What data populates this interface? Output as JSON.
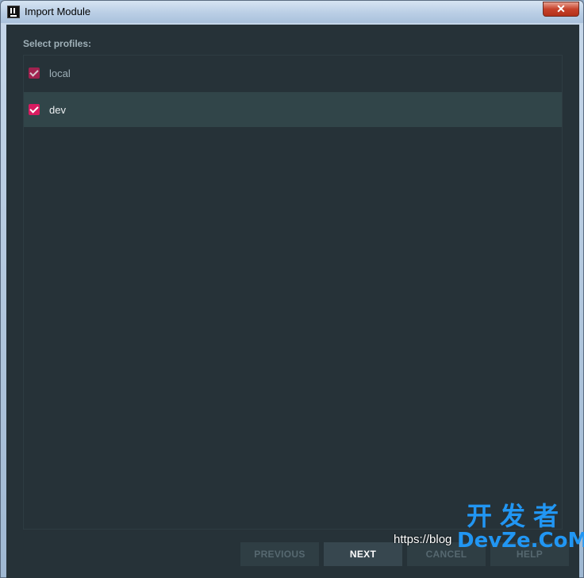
{
  "window": {
    "title": "Import Module",
    "close_glyph": "✕"
  },
  "main": {
    "section_label": "Select profiles:",
    "profiles": [
      {
        "label": "local",
        "checked": true,
        "selected": false
      },
      {
        "label": "dev",
        "checked": true,
        "selected": true
      }
    ]
  },
  "buttons": {
    "previous": "PREVIOUS",
    "next": "NEXT",
    "cancel": "CANCEL",
    "help": "HELP"
  },
  "watermark": {
    "url": "https://blog",
    "logo_cn": "开发者",
    "logo_en": "DevZe.CoM"
  },
  "colors": {
    "accent": "#d81b60",
    "background": "#263238",
    "selected_row": "#314549"
  }
}
